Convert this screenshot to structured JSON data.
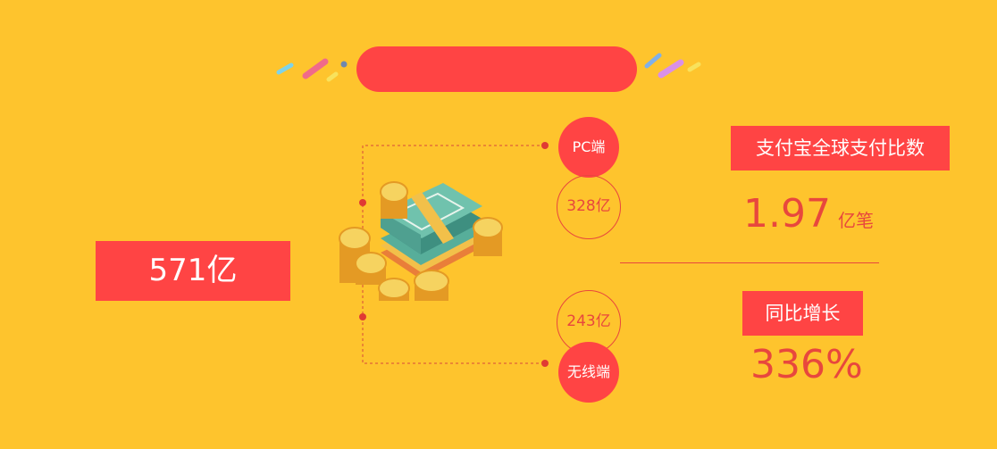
{
  "total": "571亿",
  "pc": {
    "label": "PC端",
    "value": "328亿"
  },
  "mobile": {
    "label": "无线端",
    "value": "243亿"
  },
  "stats": {
    "count_label": "支付宝全球支付比数",
    "count_value": "1.97",
    "count_unit": "亿笔",
    "growth_label": "同比增长",
    "growth_value": "336%"
  },
  "colors": {
    "background": "#FEC42D",
    "accent": "#FF4444",
    "text_accent": "#E8473D"
  },
  "icons": [
    "money-stack-icon",
    "gold-coin-icon",
    "confetti-icon"
  ]
}
